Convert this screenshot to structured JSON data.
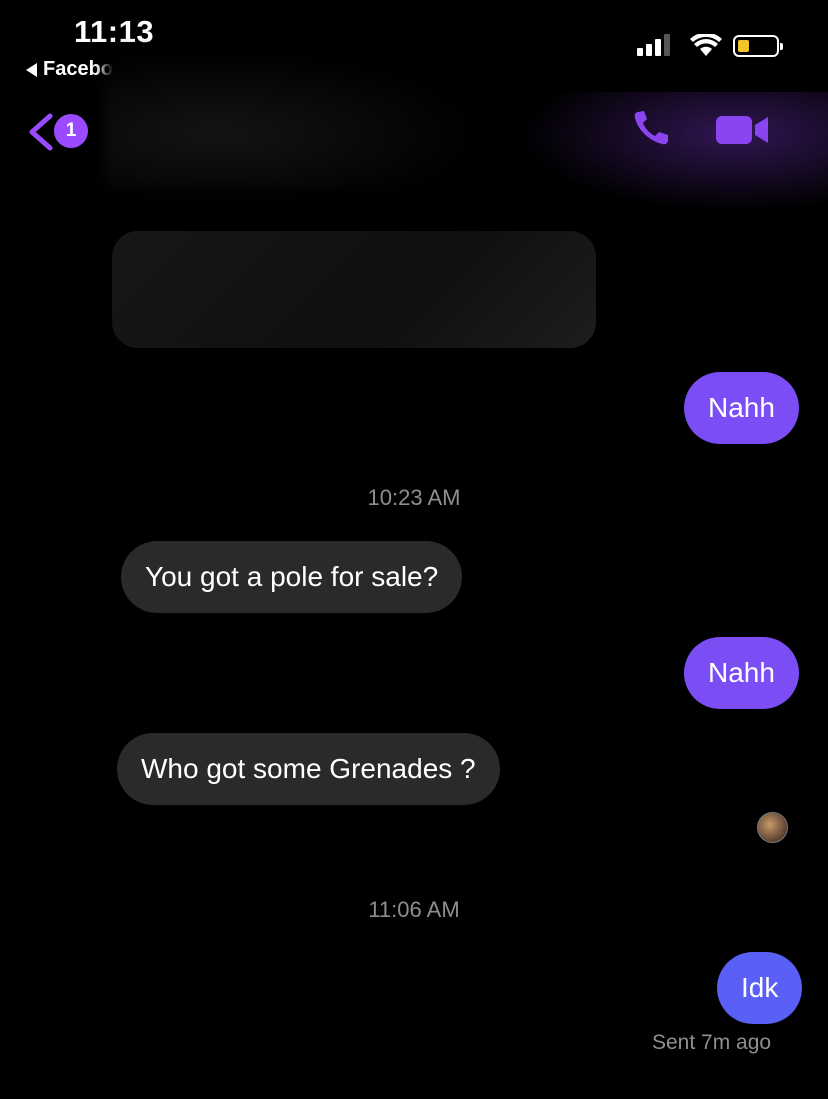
{
  "status_bar": {
    "time": "11:13",
    "back_app_label": "Facebo",
    "battery_fill_fraction": 0.3,
    "battery_color": "#f3c52b"
  },
  "header": {
    "unread_count": "1",
    "accent_color": "#9a4bff",
    "icons": [
      "chevron-left-icon",
      "phone-icon",
      "video-camera-icon"
    ]
  },
  "messages": [
    {
      "direction": "outgoing",
      "text": "Nahh"
    },
    {
      "type": "timestamp",
      "text": "10:23 AM"
    },
    {
      "direction": "incoming",
      "text": "You got a pole for sale?"
    },
    {
      "direction": "outgoing",
      "text": "Nahh"
    },
    {
      "direction": "incoming",
      "text": "Who got some Grenades ?"
    },
    {
      "type": "timestamp",
      "text": "11:06 AM"
    },
    {
      "direction": "outgoing",
      "text": "Idk"
    }
  ],
  "delivery_status": "Sent 7m ago",
  "colors": {
    "outgoing_bubble": "#7b4ef5",
    "outgoing_bubble_latest": "#5a5ff5",
    "incoming_bubble": "#2a2a2a",
    "background": "#000000"
  }
}
